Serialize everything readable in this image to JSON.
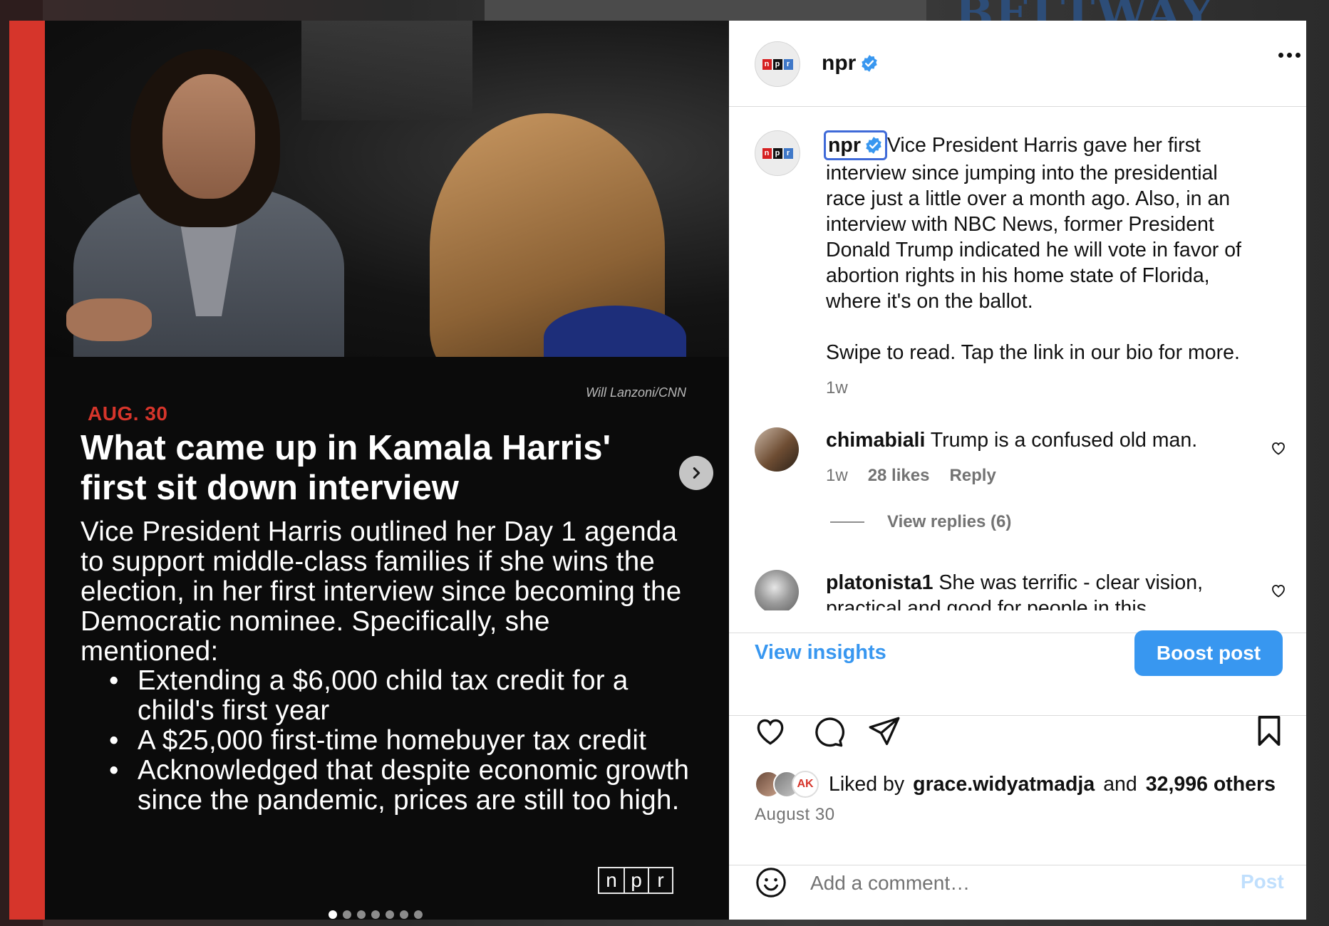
{
  "backdrop": {
    "header_word": "BELTWAY"
  },
  "post_media": {
    "credit": "Will Lanzoni/CNN",
    "date": "AUG. 30",
    "headline": "What came up in Kamala Harris' first sit down interview",
    "summary": "Vice President Harris outlined her Day 1 agenda to support middle-class families if she wins the election, in her first interview since becoming the Democratic nominee. Specifically, she mentioned:",
    "bullets": [
      "Extending a $6,000 child tax credit for a child's first year",
      "A $25,000 first-time homebuyer tax credit",
      "Acknowledged that despite economic growth since the pandemic, prices are still too high."
    ],
    "logo_letters": [
      "n",
      "p",
      "r"
    ],
    "slide_count": 7,
    "active_slide": 1
  },
  "header": {
    "username": "npr",
    "verified": true
  },
  "caption": {
    "username": "npr",
    "text_first": "Vice President Harris gave her first interview since jumping into the presidential race just a little over a month ago. Also, in an interview with NBC News, former President Donald Trump indicated he will vote in favor of abortion rights in his home state of Florida, where it's on the ballot.",
    "text_second": "Swipe to read. Tap the link in our bio for more.",
    "age": "1w"
  },
  "comments": [
    {
      "username": "chimabiali",
      "text": "Trump is a confused old man.",
      "age": "1w",
      "likes": "28 likes",
      "reply_label": "Reply",
      "view_replies": "View replies (6)"
    },
    {
      "username": "platonista1",
      "text": "She was terrific - clear vision, practical and good for people in this"
    }
  ],
  "insights": {
    "view_insights": "View insights",
    "boost_post": "Boost post"
  },
  "likes": {
    "prefix": "Liked by",
    "first_user": "grace.widyatmadja",
    "connector": "and",
    "others": "32,996 others"
  },
  "post_date": "August 30",
  "comment_box": {
    "placeholder": "Add a comment…",
    "post_label": "Post"
  },
  "colors": {
    "brand_red": "#d6352b",
    "link_blue": "#3897f0",
    "verified_blue": "#3897f0",
    "focus_outline": "#3f6ad8"
  },
  "icons": {
    "next": "chevron-right-icon",
    "like": "heart-icon",
    "comment": "speech-bubble-icon",
    "share": "paper-plane-icon",
    "save": "bookmark-icon",
    "emoji": "smiley-icon",
    "more": "more-horizontal-icon"
  }
}
